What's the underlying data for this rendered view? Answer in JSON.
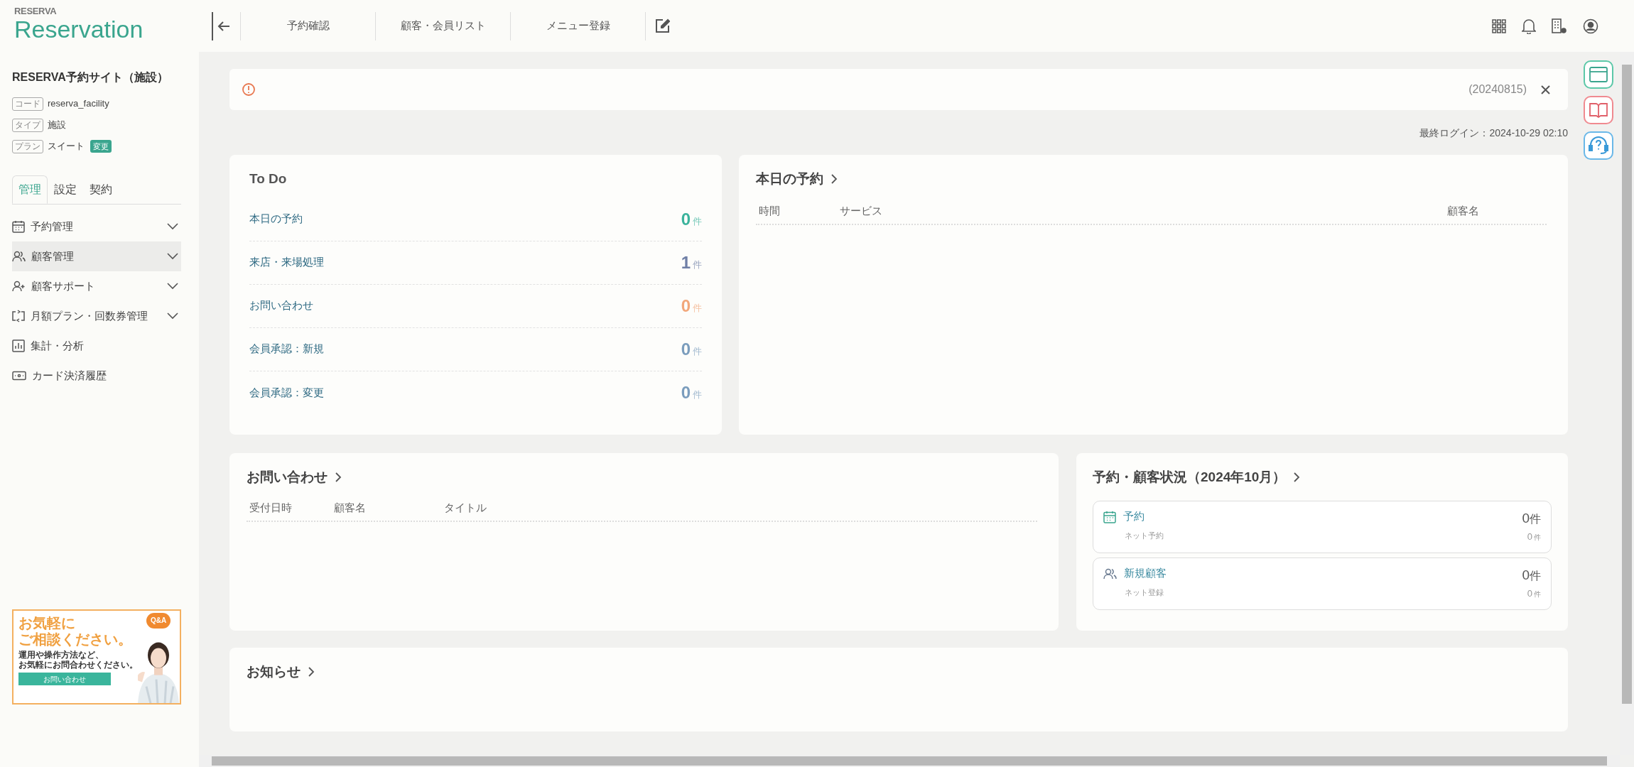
{
  "logo": {
    "brand": "RESERVA",
    "product": "Reservation"
  },
  "header": {
    "nav": [
      "予約確認",
      "顧客・会員リスト",
      "メニュー登録"
    ]
  },
  "sidebar": {
    "site_name": "RESERVA予約サイト（施設）",
    "info": [
      {
        "label": "コード",
        "value": "reserva_facility"
      },
      {
        "label": "タイプ",
        "value": "施設"
      },
      {
        "label": "プラン",
        "value": "スイート",
        "badge": "変更"
      }
    ],
    "tabs": [
      {
        "label": "管理",
        "selected": true
      },
      {
        "label": "設定",
        "selected": false
      },
      {
        "label": "契約",
        "selected": false
      }
    ],
    "menu": [
      {
        "label": "予約管理",
        "expandable": true,
        "highlighted": false
      },
      {
        "label": "顧客管理",
        "expandable": true,
        "highlighted": true
      },
      {
        "label": "顧客サポート",
        "expandable": true,
        "highlighted": false
      },
      {
        "label": "月額プラン・回数券管理",
        "expandable": true,
        "highlighted": false
      },
      {
        "label": "集計・分析",
        "expandable": false,
        "highlighted": false
      },
      {
        "label": "カード決済履歴",
        "expandable": false,
        "highlighted": false
      }
    ],
    "banner": {
      "headline": [
        "お気軽に",
        "ご相談ください。"
      ],
      "bubble": "Q&A",
      "body": [
        "運用や操作方法など、",
        "お気軽にお問合わせください。"
      ],
      "button": "お問い合わせ"
    }
  },
  "notice": {
    "text": "(20240815)"
  },
  "last_login": "最終ログイン：2024-10-29 02:10",
  "todo": {
    "title": "To Do",
    "rows": [
      {
        "label": "本日の予約",
        "count": "0",
        "unit": "件",
        "color": "#3bb39c"
      },
      {
        "label": "来店・来場処理",
        "count": "1",
        "unit": "件",
        "color": "#6f7fa6"
      },
      {
        "label": "お問い合わせ",
        "count": "0",
        "unit": "件",
        "color": "#f2a77a"
      },
      {
        "label": "会員承認：新規",
        "count": "0",
        "unit": "件",
        "color": "#7b9dbd"
      },
      {
        "label": "会員承認：変更",
        "count": "0",
        "unit": "件",
        "color": "#7b9dbd"
      }
    ]
  },
  "today": {
    "title": "本日の予約",
    "columns": [
      "時間",
      "サービス",
      "顧客名"
    ]
  },
  "inquiries": {
    "title": "お問い合わせ",
    "columns": [
      "受付日時",
      "顧客名",
      "タイトル"
    ]
  },
  "status": {
    "title": "予約・顧客状況（2024年10月）",
    "cards": [
      {
        "label": "予約",
        "count": "0",
        "unit": "件",
        "sub_label": "ネット予約",
        "sub_count": "0",
        "sub_unit": "件"
      },
      {
        "label": "新規顧客",
        "count": "0",
        "unit": "件",
        "sub_label": "ネット登録",
        "sub_count": "0",
        "sub_unit": "件"
      }
    ]
  },
  "news": {
    "title": "お知らせ"
  }
}
